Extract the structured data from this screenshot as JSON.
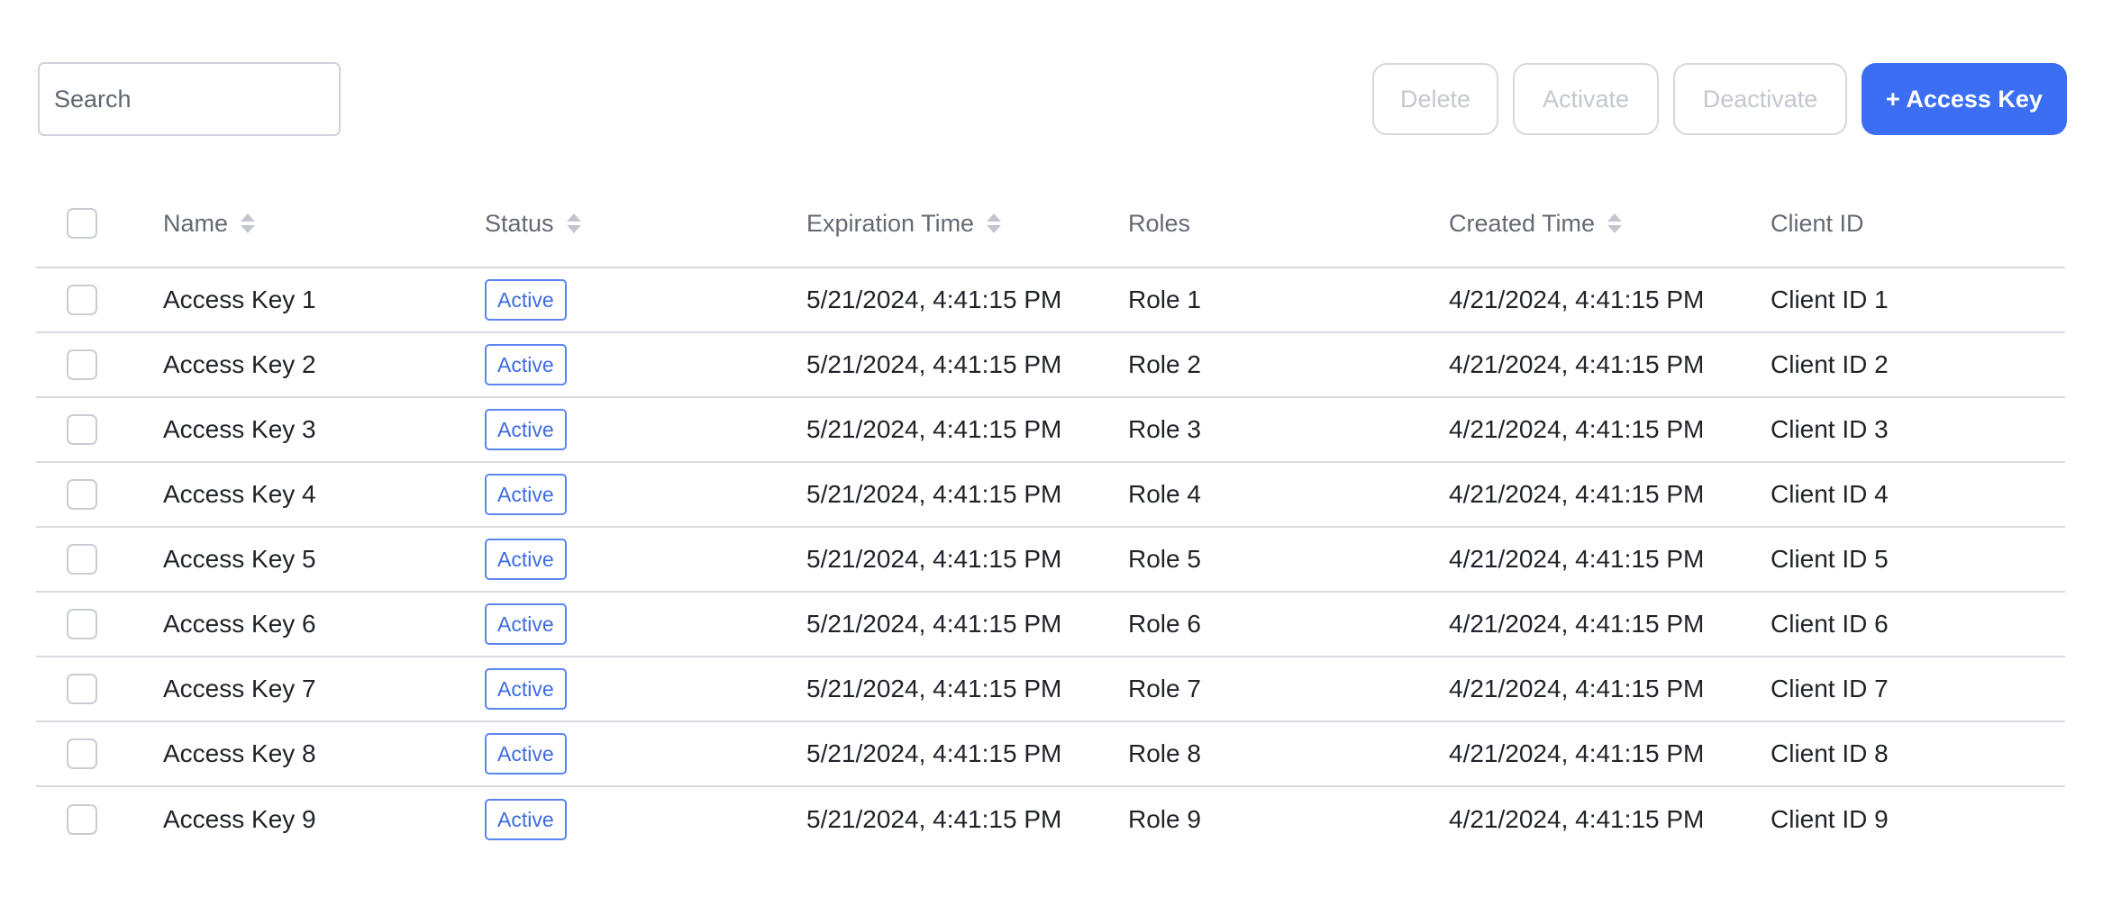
{
  "search": {
    "placeholder": "Search",
    "value": ""
  },
  "toolbar": {
    "delete_label": "Delete",
    "activate_label": "Activate",
    "deactivate_label": "Deactivate",
    "add_label": "+ Access Key"
  },
  "colors": {
    "primary": "#3b6ef2",
    "badge_border": "#5b86f0",
    "badge_text": "#3d6ce0",
    "disabled_text": "#c3c8cf",
    "row_border": "#d7dadf"
  },
  "table": {
    "columns": {
      "name": "Name",
      "status": "Status",
      "expiration": "Expiration Time",
      "roles": "Roles",
      "created": "Created Time",
      "client_id": "Client ID"
    },
    "rows": [
      {
        "name": "Access Key 1",
        "status": "Active",
        "expiration": "5/21/2024, 4:41:15 PM",
        "role": "Role 1",
        "created": "4/21/2024, 4:41:15 PM",
        "client_id": "Client ID 1"
      },
      {
        "name": "Access Key 2",
        "status": "Active",
        "expiration": "5/21/2024, 4:41:15 PM",
        "role": "Role 2",
        "created": "4/21/2024, 4:41:15 PM",
        "client_id": "Client ID 2"
      },
      {
        "name": "Access Key 3",
        "status": "Active",
        "expiration": "5/21/2024, 4:41:15 PM",
        "role": "Role 3",
        "created": "4/21/2024, 4:41:15 PM",
        "client_id": "Client ID 3"
      },
      {
        "name": "Access Key 4",
        "status": "Active",
        "expiration": "5/21/2024, 4:41:15 PM",
        "role": "Role 4",
        "created": "4/21/2024, 4:41:15 PM",
        "client_id": "Client ID 4"
      },
      {
        "name": "Access Key 5",
        "status": "Active",
        "expiration": "5/21/2024, 4:41:15 PM",
        "role": "Role 5",
        "created": "4/21/2024, 4:41:15 PM",
        "client_id": "Client ID 5"
      },
      {
        "name": "Access Key 6",
        "status": "Active",
        "expiration": "5/21/2024, 4:41:15 PM",
        "role": "Role 6",
        "created": "4/21/2024, 4:41:15 PM",
        "client_id": "Client ID 6"
      },
      {
        "name": "Access Key 7",
        "status": "Active",
        "expiration": "5/21/2024, 4:41:15 PM",
        "role": "Role 7",
        "created": "4/21/2024, 4:41:15 PM",
        "client_id": "Client ID 7"
      },
      {
        "name": "Access Key 8",
        "status": "Active",
        "expiration": "5/21/2024, 4:41:15 PM",
        "role": "Role 8",
        "created": "4/21/2024, 4:41:15 PM",
        "client_id": "Client ID 8"
      },
      {
        "name": "Access Key 9",
        "status": "Active",
        "expiration": "5/21/2024, 4:41:15 PM",
        "role": "Role 9",
        "created": "4/21/2024, 4:41:15 PM",
        "client_id": "Client ID 9"
      }
    ]
  }
}
